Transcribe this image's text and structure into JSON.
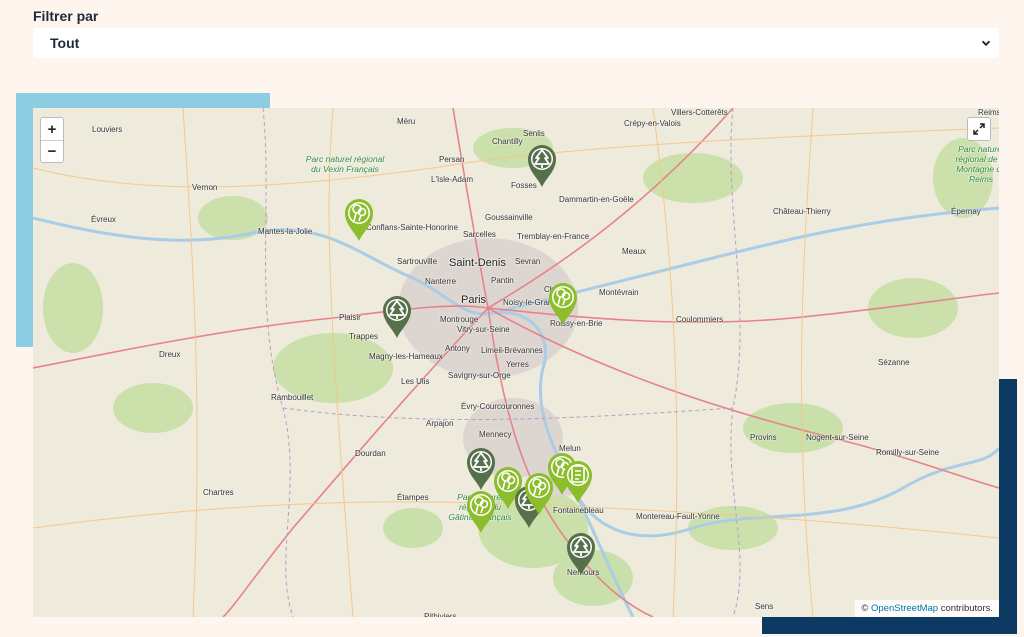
{
  "filter": {
    "label": "Filtrer par",
    "selected": "Tout"
  },
  "map": {
    "zoom_in": "+",
    "zoom_out": "−",
    "attribution_prefix": "©",
    "attribution_link": "OpenStreetMap",
    "attribution_suffix": "contributors.",
    "places": [
      {
        "name": "Louviers"
      },
      {
        "name": "Méru"
      },
      {
        "name": "Senlis"
      },
      {
        "name": "Crépy-en-Valois"
      },
      {
        "name": "Villers-Cotterêts"
      },
      {
        "name": "Reims"
      },
      {
        "name": "Persan"
      },
      {
        "name": "Chantilly"
      },
      {
        "name": "Vernon"
      },
      {
        "name": "L'Isle-Adam"
      },
      {
        "name": "Fosses"
      },
      {
        "name": "Dammartin-en-Goële"
      },
      {
        "name": "Évreux"
      },
      {
        "name": "Goussainville"
      },
      {
        "name": "Château-Thierry"
      },
      {
        "name": "Épernay"
      },
      {
        "name": "Mantes-la-Jolie"
      },
      {
        "name": "Conflans-Sainte-Honorine"
      },
      {
        "name": "Sarcelles"
      },
      {
        "name": "Tremblay-en-France"
      },
      {
        "name": "Sartrouville"
      },
      {
        "name": "Saint-Denis"
      },
      {
        "name": "Sevran"
      },
      {
        "name": "Meaux"
      },
      {
        "name": "Nanterre"
      },
      {
        "name": "Pantin"
      },
      {
        "name": "Chelles"
      },
      {
        "name": "Montévrain"
      },
      {
        "name": "Paris"
      },
      {
        "name": "Noisy-le-Grand"
      },
      {
        "name": "Plaisir"
      },
      {
        "name": "Montrouge"
      },
      {
        "name": "Vitry-sur-Seine"
      },
      {
        "name": "Roissy-en-Brie"
      },
      {
        "name": "Coulommiers"
      },
      {
        "name": "Trappes"
      },
      {
        "name": "Antony"
      },
      {
        "name": "Limeil-Brévannes"
      },
      {
        "name": "Dreux"
      },
      {
        "name": "Magny-les-Hameaux"
      },
      {
        "name": "Yerres"
      },
      {
        "name": "Sézanne"
      },
      {
        "name": "Les Ulis"
      },
      {
        "name": "Savigny-sur-Orge"
      },
      {
        "name": "Rambouillet"
      },
      {
        "name": "Évry-Courcouronnes"
      },
      {
        "name": "Arpajon"
      },
      {
        "name": "Mennecy"
      },
      {
        "name": "Provins"
      },
      {
        "name": "Dourdan"
      },
      {
        "name": "Melun"
      },
      {
        "name": "Nogent-sur-Seine"
      },
      {
        "name": "Romilly-sur-Seine"
      },
      {
        "name": "Chartres"
      },
      {
        "name": "Étampes"
      },
      {
        "name": "Fontainebleau"
      },
      {
        "name": "Montereau-Fault-Yonne"
      },
      {
        "name": "Nemours"
      },
      {
        "name": "Sens"
      },
      {
        "name": "Pithiviers"
      }
    ],
    "parks": [
      {
        "name": "Parc naturel régional du Vexin Français"
      },
      {
        "name": "Parc naturel régional du Gâtinais français"
      },
      {
        "name": "Parc naturel régional de la Montagne de Reims"
      }
    ],
    "markers": [
      {
        "type": "forest"
      },
      {
        "type": "tree"
      },
      {
        "type": "forest"
      },
      {
        "type": "tree"
      },
      {
        "type": "forest"
      },
      {
        "type": "tree"
      },
      {
        "type": "tree"
      },
      {
        "type": "forest"
      },
      {
        "type": "tree"
      },
      {
        "type": "tree"
      },
      {
        "type": "info"
      },
      {
        "type": "forest"
      }
    ]
  }
}
